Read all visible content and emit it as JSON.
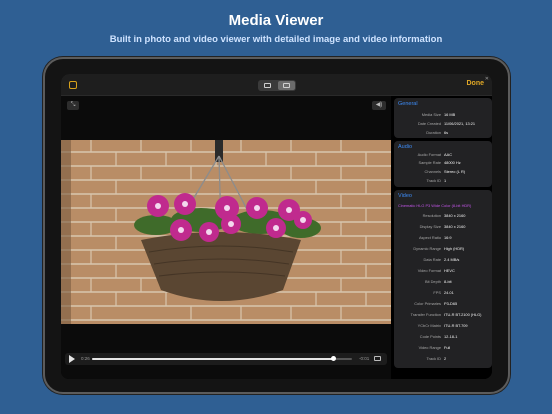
{
  "hero": {
    "title": "Media Viewer",
    "subtitle": "Built in photo and video viewer with detailed image and video information"
  },
  "toolbar": {
    "done_label": "Done",
    "accent_color": "#e0a826"
  },
  "player": {
    "current_time": "0:26",
    "remaining_time": "-0:01",
    "progress": 0.93
  },
  "info": {
    "general": {
      "title": "General",
      "rows": [
        {
          "label": "Media Size",
          "value": "16 MB"
        },
        {
          "label": "Date Created",
          "value": "11/06/2021, 13:21"
        },
        {
          "label": "Duration",
          "value": "6s"
        }
      ]
    },
    "audio": {
      "title": "Audio",
      "rows": [
        {
          "label": "Audio Format",
          "value": "AAC"
        },
        {
          "label": "Sample Rate",
          "value": "48000 Hz"
        },
        {
          "label": "Channels",
          "value": "Stereo (L R)"
        },
        {
          "label": "Track ID",
          "value": "1"
        }
      ]
    },
    "video": {
      "title": "Video",
      "highlight": "Cinematic HLG P3 Wide Color (8-bit HDR)",
      "rows": [
        {
          "label": "Resolution",
          "value": "3840 x 2160"
        },
        {
          "label": "Display Size",
          "value": "3840 x 2160"
        },
        {
          "label": "Aspect Ratio",
          "value": "16:9"
        },
        {
          "label": "Dynamic Range",
          "value": "High (HDR)"
        },
        {
          "label": "Data Rate",
          "value": "2.4 MB/s"
        },
        {
          "label": "Video Format",
          "value": "HEVC"
        },
        {
          "label": "Bit Depth",
          "value": "8-bit"
        },
        {
          "label": "FPS",
          "value": "24.01"
        },
        {
          "label": "Color Primaries",
          "value": "P3-D65"
        },
        {
          "label": "Transfer Function",
          "value": "ITU-R BT.2100 (HLG)"
        },
        {
          "label": "YCbCr Matrix",
          "value": "ITU-R BT.709"
        },
        {
          "label": "Code Points",
          "value": "12-18-1"
        },
        {
          "label": "Video Range",
          "value": "Full"
        },
        {
          "label": "Track ID",
          "value": "2"
        }
      ]
    }
  }
}
